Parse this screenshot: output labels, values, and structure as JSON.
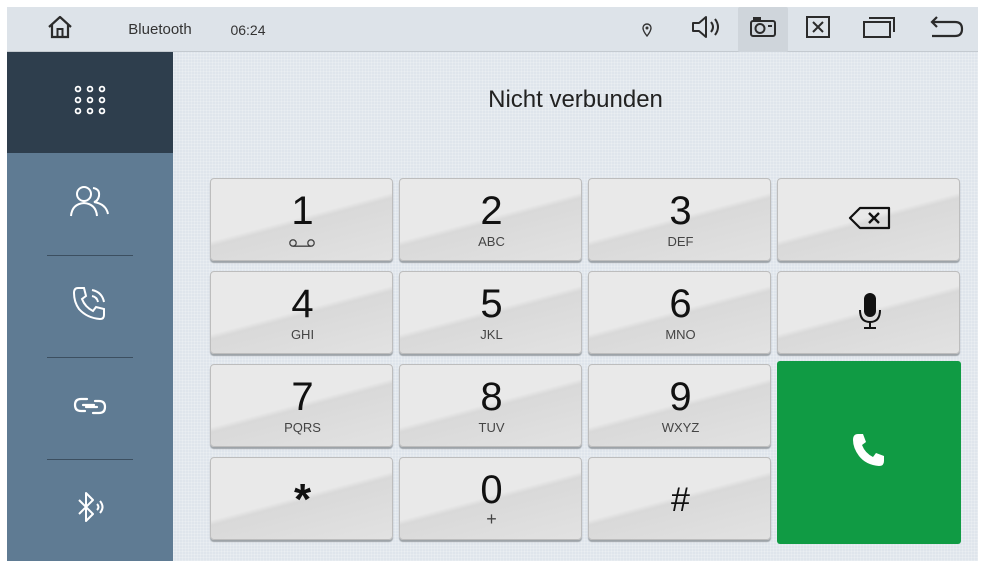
{
  "status_bar": {
    "app_label": "Bluetooth",
    "time": "06:24",
    "icons": [
      "home-icon",
      "location-pin-icon",
      "volume-icon",
      "screenshot-icon",
      "close-window-icon",
      "recent-apps-icon",
      "back-icon"
    ]
  },
  "sidebar": {
    "items": [
      {
        "name": "dialpad",
        "icon": "dialpad-icon",
        "active": true
      },
      {
        "name": "contacts",
        "icon": "contacts-icon",
        "active": false
      },
      {
        "name": "call-log",
        "icon": "call-log-icon",
        "active": false
      },
      {
        "name": "pairing",
        "icon": "link-icon",
        "active": false
      },
      {
        "name": "bluetooth-audio",
        "icon": "bluetooth-audio-icon",
        "active": false
      }
    ]
  },
  "main": {
    "connection_status": "Nicht verbunden"
  },
  "keypad": {
    "keys": [
      {
        "digit": "1",
        "letters": ""
      },
      {
        "digit": "2",
        "letters": "ABC"
      },
      {
        "digit": "3",
        "letters": "DEF"
      },
      {
        "digit": "4",
        "letters": "GHI"
      },
      {
        "digit": "5",
        "letters": "JKL"
      },
      {
        "digit": "6",
        "letters": "MNO"
      },
      {
        "digit": "7",
        "letters": "PQRS"
      },
      {
        "digit": "8",
        "letters": "TUV"
      },
      {
        "digit": "9",
        "letters": "WXYZ"
      },
      {
        "digit": "*",
        "letters": ""
      },
      {
        "digit": "0",
        "letters": "+"
      },
      {
        "digit": "#",
        "letters": ""
      }
    ],
    "backspace_icon": "backspace-icon",
    "voice_icon": "microphone-icon",
    "call_icon": "phone-icon"
  },
  "colors": {
    "status_bar_bg": "#dde3e9",
    "sidebar_bg": "#5f7b93",
    "sidebar_active_bg": "#2e3e4d",
    "call_button": "#109b44",
    "key_bg": "#e9e9e9"
  }
}
